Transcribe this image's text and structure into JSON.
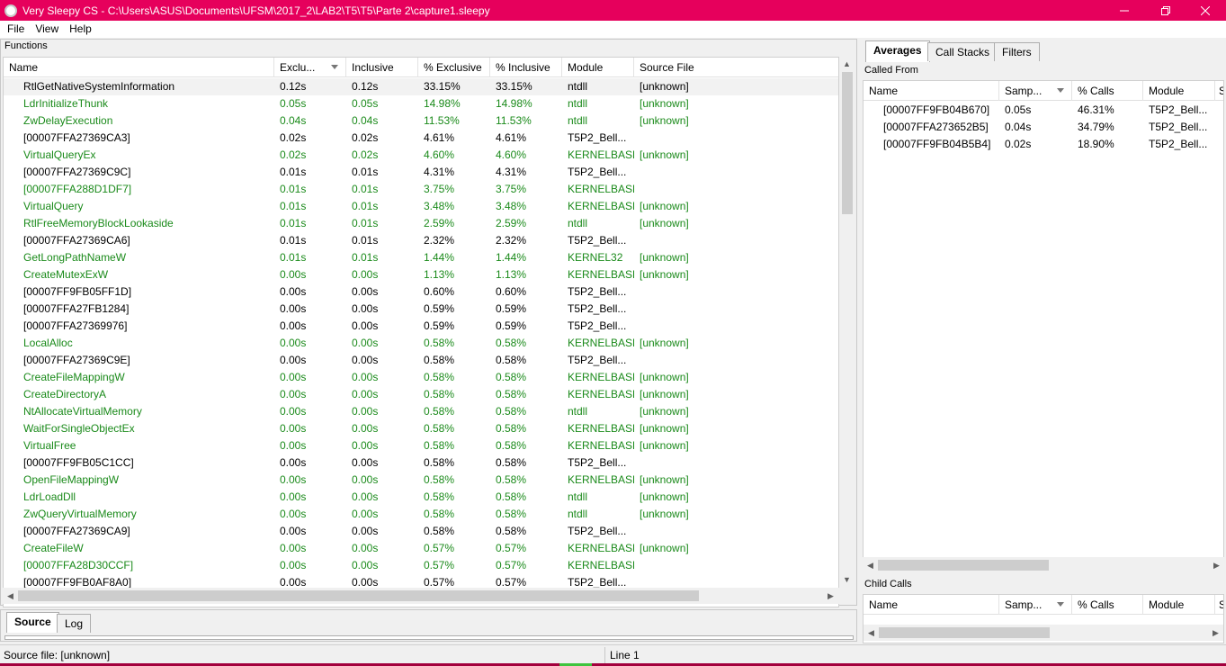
{
  "window": {
    "title": "Very Sleepy CS - C:\\Users\\ASUS\\Documents\\UFSM\\2017_2\\LAB2\\T5\\T5\\Parte 2\\capture1.sleepy",
    "controls": [
      "minimize-icon",
      "restore-icon",
      "close-icon"
    ]
  },
  "menu": {
    "file": "File",
    "view": "View",
    "help": "Help"
  },
  "functions_panel": {
    "label": "Functions",
    "columns": {
      "name": "Name",
      "exclusive": "Exclu...",
      "inclusive": "Inclusive",
      "pct_exclusive": "% Exclusive",
      "pct_inclusive": "% Inclusive",
      "module": "Module",
      "source_file": "Source File"
    },
    "rows": [
      {
        "name": "RtlGetNativeSystemInformation",
        "excl": "0.12s",
        "incl": "0.12s",
        "pexcl": "33.15%",
        "pincl": "33.15%",
        "module": "ntdll",
        "source": "[unknown]",
        "color": "black"
      },
      {
        "name": "LdrInitializeThunk",
        "excl": "0.05s",
        "incl": "0.05s",
        "pexcl": "14.98%",
        "pincl": "14.98%",
        "module": "ntdll",
        "source": "[unknown]",
        "color": "green"
      },
      {
        "name": "ZwDelayExecution",
        "excl": "0.04s",
        "incl": "0.04s",
        "pexcl": "11.53%",
        "pincl": "11.53%",
        "module": "ntdll",
        "source": "[unknown]",
        "color": "green"
      },
      {
        "name": "[00007FFA27369CA3]",
        "excl": "0.02s",
        "incl": "0.02s",
        "pexcl": "4.61%",
        "pincl": "4.61%",
        "module": "T5P2_Bell...",
        "source": "",
        "color": "black"
      },
      {
        "name": "VirtualQueryEx",
        "excl": "0.02s",
        "incl": "0.02s",
        "pexcl": "4.60%",
        "pincl": "4.60%",
        "module": "KERNELBASE",
        "source": "[unknown]",
        "color": "green"
      },
      {
        "name": "[00007FFA27369C9C]",
        "excl": "0.01s",
        "incl": "0.01s",
        "pexcl": "4.31%",
        "pincl": "4.31%",
        "module": "T5P2_Bell...",
        "source": "",
        "color": "black"
      },
      {
        "name": "[00007FFA288D1DF7]",
        "excl": "0.01s",
        "incl": "0.01s",
        "pexcl": "3.75%",
        "pincl": "3.75%",
        "module": "KERNELBASE",
        "source": "",
        "color": "green"
      },
      {
        "name": "VirtualQuery",
        "excl": "0.01s",
        "incl": "0.01s",
        "pexcl": "3.48%",
        "pincl": "3.48%",
        "module": "KERNELBASE",
        "source": "[unknown]",
        "color": "green"
      },
      {
        "name": "RtlFreeMemoryBlockLookaside",
        "excl": "0.01s",
        "incl": "0.01s",
        "pexcl": "2.59%",
        "pincl": "2.59%",
        "module": "ntdll",
        "source": "[unknown]",
        "color": "green"
      },
      {
        "name": "[00007FFA27369CA6]",
        "excl": "0.01s",
        "incl": "0.01s",
        "pexcl": "2.32%",
        "pincl": "2.32%",
        "module": "T5P2_Bell...",
        "source": "",
        "color": "black"
      },
      {
        "name": "GetLongPathNameW",
        "excl": "0.01s",
        "incl": "0.01s",
        "pexcl": "1.44%",
        "pincl": "1.44%",
        "module": "KERNEL32",
        "source": "[unknown]",
        "color": "green"
      },
      {
        "name": "CreateMutexExW",
        "excl": "0.00s",
        "incl": "0.00s",
        "pexcl": "1.13%",
        "pincl": "1.13%",
        "module": "KERNELBASE",
        "source": "[unknown]",
        "color": "green"
      },
      {
        "name": "[00007FF9FB05FF1D]",
        "excl": "0.00s",
        "incl": "0.00s",
        "pexcl": "0.60%",
        "pincl": "0.60%",
        "module": "T5P2_Bell...",
        "source": "",
        "color": "black"
      },
      {
        "name": "[00007FFA27FB1284]",
        "excl": "0.00s",
        "incl": "0.00s",
        "pexcl": "0.59%",
        "pincl": "0.59%",
        "module": "T5P2_Bell...",
        "source": "",
        "color": "black"
      },
      {
        "name": "[00007FFA27369976]",
        "excl": "0.00s",
        "incl": "0.00s",
        "pexcl": "0.59%",
        "pincl": "0.59%",
        "module": "T5P2_Bell...",
        "source": "",
        "color": "black"
      },
      {
        "name": "LocalAlloc",
        "excl": "0.00s",
        "incl": "0.00s",
        "pexcl": "0.58%",
        "pincl": "0.58%",
        "module": "KERNELBASE",
        "source": "[unknown]",
        "color": "green"
      },
      {
        "name": "[00007FFA27369C9E]",
        "excl": "0.00s",
        "incl": "0.00s",
        "pexcl": "0.58%",
        "pincl": "0.58%",
        "module": "T5P2_Bell...",
        "source": "",
        "color": "black"
      },
      {
        "name": "CreateFileMappingW",
        "excl": "0.00s",
        "incl": "0.00s",
        "pexcl": "0.58%",
        "pincl": "0.58%",
        "module": "KERNELBASE",
        "source": "[unknown]",
        "color": "green"
      },
      {
        "name": "CreateDirectoryA",
        "excl": "0.00s",
        "incl": "0.00s",
        "pexcl": "0.58%",
        "pincl": "0.58%",
        "module": "KERNELBASE",
        "source": "[unknown]",
        "color": "green"
      },
      {
        "name": "NtAllocateVirtualMemory",
        "excl": "0.00s",
        "incl": "0.00s",
        "pexcl": "0.58%",
        "pincl": "0.58%",
        "module": "ntdll",
        "source": "[unknown]",
        "color": "green"
      },
      {
        "name": "WaitForSingleObjectEx",
        "excl": "0.00s",
        "incl": "0.00s",
        "pexcl": "0.58%",
        "pincl": "0.58%",
        "module": "KERNELBASE",
        "source": "[unknown]",
        "color": "green"
      },
      {
        "name": "VirtualFree",
        "excl": "0.00s",
        "incl": "0.00s",
        "pexcl": "0.58%",
        "pincl": "0.58%",
        "module": "KERNELBASE",
        "source": "[unknown]",
        "color": "green"
      },
      {
        "name": "[00007FF9FB05C1CC]",
        "excl": "0.00s",
        "incl": "0.00s",
        "pexcl": "0.58%",
        "pincl": "0.58%",
        "module": "T5P2_Bell...",
        "source": "",
        "color": "black"
      },
      {
        "name": "OpenFileMappingW",
        "excl": "0.00s",
        "incl": "0.00s",
        "pexcl": "0.58%",
        "pincl": "0.58%",
        "module": "KERNELBASE",
        "source": "[unknown]",
        "color": "green"
      },
      {
        "name": "LdrLoadDll",
        "excl": "0.00s",
        "incl": "0.00s",
        "pexcl": "0.58%",
        "pincl": "0.58%",
        "module": "ntdll",
        "source": "[unknown]",
        "color": "green"
      },
      {
        "name": "ZwQueryVirtualMemory",
        "excl": "0.00s",
        "incl": "0.00s",
        "pexcl": "0.58%",
        "pincl": "0.58%",
        "module": "ntdll",
        "source": "[unknown]",
        "color": "green"
      },
      {
        "name": "[00007FFA27369CA9]",
        "excl": "0.00s",
        "incl": "0.00s",
        "pexcl": "0.58%",
        "pincl": "0.58%",
        "module": "T5P2_Bell...",
        "source": "",
        "color": "black"
      },
      {
        "name": "CreateFileW",
        "excl": "0.00s",
        "incl": "0.00s",
        "pexcl": "0.57%",
        "pincl": "0.57%",
        "module": "KERNELBASE",
        "source": "[unknown]",
        "color": "green"
      },
      {
        "name": "[00007FFA28D30CCF]",
        "excl": "0.00s",
        "incl": "0.00s",
        "pexcl": "0.57%",
        "pincl": "0.57%",
        "module": "KERNELBASE",
        "source": "",
        "color": "green"
      },
      {
        "name": "[00007FF9FB0AF8A0]",
        "excl": "0.00s",
        "incl": "0.00s",
        "pexcl": "0.57%",
        "pincl": "0.57%",
        "module": "T5P2_Bell...",
        "source": "",
        "color": "black"
      }
    ]
  },
  "bottom_tabs": {
    "source": "Source",
    "log": "Log"
  },
  "right_tabs": {
    "averages": "Averages",
    "call_stacks": "Call Stacks",
    "filters": "Filters"
  },
  "called_from": {
    "label": "Called From",
    "columns": {
      "name": "Name",
      "samples": "Samp...",
      "pct_calls": "% Calls",
      "module": "Module",
      "extra": "S"
    },
    "rows": [
      {
        "name": "[00007FF9FB04B670]",
        "samples": "0.05s",
        "pct": "46.31%",
        "module": "T5P2_Bell..."
      },
      {
        "name": "[00007FFA273652B5]",
        "samples": "0.04s",
        "pct": "34.79%",
        "module": "T5P2_Bell..."
      },
      {
        "name": "[00007FF9FB04B5B4]",
        "samples": "0.02s",
        "pct": "18.90%",
        "module": "T5P2_Bell..."
      }
    ]
  },
  "child_calls": {
    "label": "Child Calls",
    "columns": {
      "name": "Name",
      "samples": "Samp...",
      "pct_calls": "% Calls",
      "module": "Module",
      "extra": "S"
    }
  },
  "status": {
    "source_file": "Source file: [unknown]",
    "line": "Line 1"
  },
  "colors": {
    "titlebar": "#e6005c",
    "green_text": "#1a8a1a",
    "taskbar": "#a3003d"
  }
}
